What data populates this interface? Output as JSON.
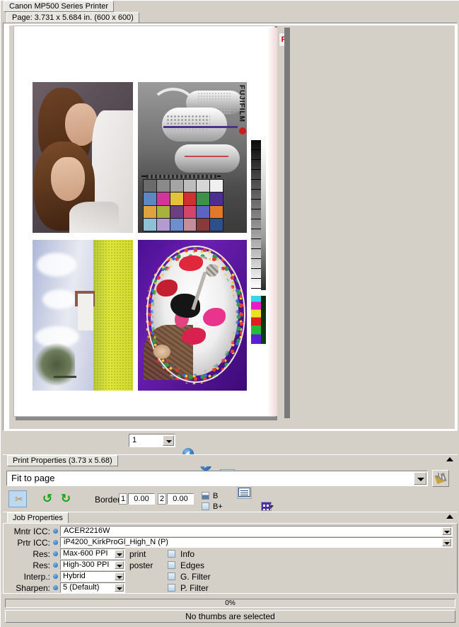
{
  "window": {
    "title": "Canon MP500 Series Printer"
  },
  "page_info": {
    "label": "Page: 3.731 x 5.684 in.  (600 x 600)"
  },
  "preview": {
    "marker_label": "F",
    "photos": [
      {
        "name": "two-girls-portrait"
      },
      {
        "name": "fujifilm-technical-grayscale",
        "brand_text": "FUJIFILM"
      },
      {
        "name": "landscape-rapeseed-field"
      },
      {
        "name": "rose-petals-bowl"
      }
    ],
    "colorchecker": {
      "rows": [
        [
          "#6b6b6b",
          "#8a8a8a",
          "#a5a5a5",
          "#bdbdbd",
          "#d6d6d6",
          "#f0f0f0"
        ],
        [
          "#5f86c4",
          "#d2349a",
          "#e6c23a",
          "#cf3030",
          "#3d9148",
          "#4c2f8f"
        ],
        [
          "#e0a23e",
          "#a9b33c",
          "#6c3f82",
          "#d6436c",
          "#5d63c0",
          "#e07a2a"
        ],
        [
          "#8fc0d8",
          "#b49ad2",
          "#6f8ed0",
          "#c78d9c",
          "#8a3a3a",
          "#2f4f8a"
        ]
      ]
    }
  },
  "toolbar": {
    "page_number": "1",
    "buttons": [
      {
        "name": "previous-page-button",
        "icon": "arrow-left-circle-icon"
      },
      {
        "name": "next-page-button",
        "icon": "arrow-right-circle-icon"
      },
      {
        "name": "portrait-page-button",
        "icon": "page-portrait-icon"
      },
      {
        "name": "landscape-page-button",
        "icon": "page-landscape-icon"
      },
      {
        "name": "layout-grid-button",
        "icon": "grid-icon"
      },
      {
        "name": "lock-button",
        "icon": "lock-icon"
      },
      {
        "name": "new-page-button",
        "icon": "blank-page-icon"
      },
      {
        "name": "page-preview-button",
        "icon": "page-magnifier-icon"
      }
    ]
  },
  "print_properties": {
    "header": "Print Properties (3.73 x 5.68)",
    "fit_mode": "Fit to page",
    "tools_icon": "hammer-wrench-icon"
  },
  "borders": {
    "crop_icon": "scissors-icon",
    "rotate_ccw_icon": "rotate-counterclockwise-icon",
    "rotate_cw_icon": "rotate-clockwise-icon",
    "label": "Borders:",
    "index1": "1",
    "value1": "0.00",
    "index2": "2",
    "value2": "0.00",
    "b_label": "B",
    "bplus_label": "B+"
  },
  "job_properties": {
    "header": "Job Properties",
    "rows": [
      {
        "label": "Mntr ICC:",
        "value": "ACER2216W"
      },
      {
        "label": "Prtr ICC:",
        "value": "iP4200_KirkProGl_High_N (P)"
      },
      {
        "label": "Res:",
        "value": "Max-600 PPI",
        "suffix": "print"
      },
      {
        "label": "Res:",
        "value": "High-300 PPI",
        "suffix": "poster"
      },
      {
        "label": "Interp.:",
        "value": "Hybrid"
      },
      {
        "label": "Sharpen:",
        "value": "5 (Default)"
      }
    ],
    "checkboxes": [
      {
        "label": "Info",
        "checked": false
      },
      {
        "label": "Edges",
        "checked": false
      },
      {
        "label": "G. Filter",
        "checked": false
      },
      {
        "label": "P. Filter",
        "checked": false
      }
    ]
  },
  "status": {
    "progress_text": "0%",
    "message": "No thumbs are selected"
  }
}
